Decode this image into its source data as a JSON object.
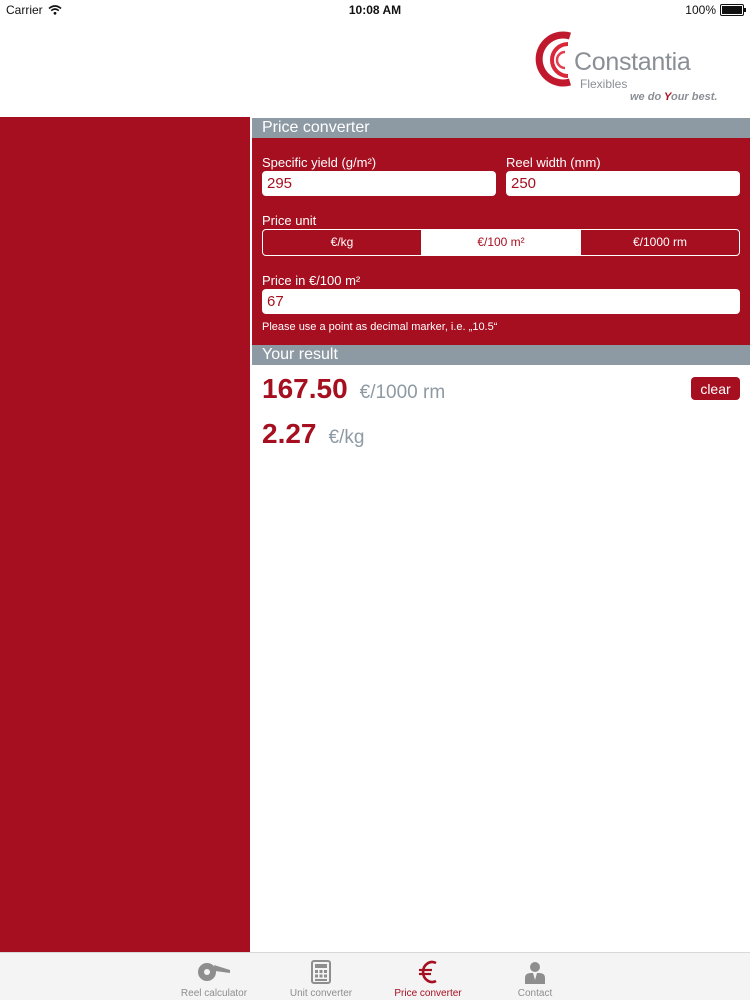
{
  "status_bar": {
    "carrier": "Carrier",
    "time": "10:08 AM",
    "battery": "100%"
  },
  "logo": {
    "name": "Constantia",
    "sub": "Flexibles",
    "tagline_pre": "we do ",
    "tagline_y": "Y",
    "tagline_post": "our best."
  },
  "price_converter": {
    "title": "Price converter",
    "specific_yield": {
      "label": "Specific yield (g/m²)",
      "value": "295"
    },
    "reel_width": {
      "label": "Reel width (mm)",
      "value": "250"
    },
    "price_unit": {
      "label": "Price unit",
      "options": [
        "€/kg",
        "€/100 m²",
        "€/1000 rm"
      ],
      "selected": "€/100 m²"
    },
    "price": {
      "label": "Price in €/100 m²",
      "value": "67"
    },
    "hint": "Please use a point as decimal marker, i.e. „10.5“"
  },
  "result": {
    "title": "Your result",
    "rows": [
      {
        "value": "167.50",
        "unit": "€/1000 rm"
      },
      {
        "value": "2.27",
        "unit": "€/kg"
      }
    ],
    "clear_label": "clear"
  },
  "tab_bar": {
    "tabs": [
      {
        "label": "Reel calculator",
        "icon": "reel-icon",
        "active": false
      },
      {
        "label": "Unit converter",
        "icon": "calculator-icon",
        "active": false
      },
      {
        "label": "Price converter",
        "icon": "euro-icon",
        "active": true
      },
      {
        "label": "Contact",
        "icon": "contact-person-icon",
        "active": false
      }
    ]
  },
  "colors": {
    "accent": "#a60f20",
    "section_header": "#8e9aa3",
    "tab_bar": "#f4f4f4"
  }
}
